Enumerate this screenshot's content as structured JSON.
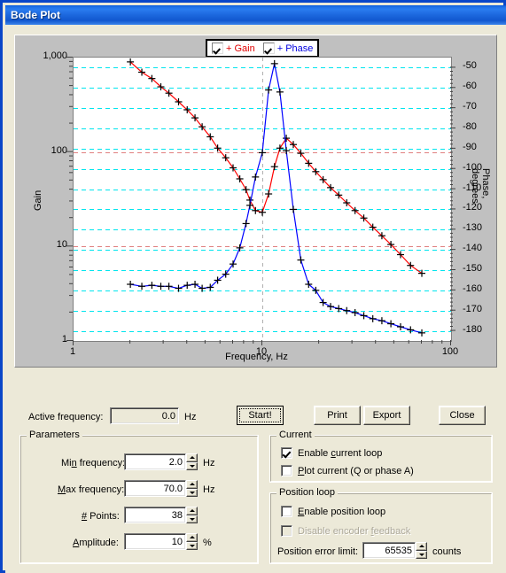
{
  "window": {
    "title": "Bode Plot"
  },
  "chart_data": {
    "type": "line",
    "title": "",
    "xlabel": "Frequency, Hz",
    "ylabel": "Gain",
    "ylabel_right": "Phase, degrees",
    "xscale": "log",
    "yscale_left": "log",
    "xlim": [
      1,
      100
    ],
    "ylim_left": [
      1,
      1000
    ],
    "ylim_right": [
      -185,
      -45
    ],
    "grid": true,
    "grid_color": "#00e5ee",
    "grid_major_color": "#e08080",
    "legend_position": "top-center",
    "xticks": [
      "1",
      "10",
      "100"
    ],
    "yticks_left": [
      "1",
      "10",
      "100",
      "1,000"
    ],
    "yticks_right": [
      "-50",
      "-60",
      "-70",
      "-80",
      "-90",
      "-100",
      "-110",
      "-120",
      "-130",
      "-140",
      "-150",
      "-160",
      "-170",
      "-180"
    ],
    "legend": [
      {
        "label": "+ Gain",
        "color": "#ff0000",
        "checked": true
      },
      {
        "label": "+ Phase",
        "color": "#0000ff",
        "checked": true
      }
    ],
    "x": [
      2.0,
      2.3,
      2.6,
      2.9,
      3.2,
      3.6,
      4.0,
      4.4,
      4.8,
      5.3,
      5.8,
      6.4,
      7.0,
      7.6,
      8.2,
      8.6,
      9.2,
      10.0,
      10.8,
      11.6,
      12.4,
      13.4,
      14.6,
      16.0,
      17.6,
      19.2,
      21.0,
      23.0,
      25.4,
      28.0,
      31.0,
      34.5,
      38.5,
      43.0,
      48.0,
      54.0,
      61.0,
      70.0
    ],
    "series": [
      {
        "name": "+ Gain",
        "color": "#ff0000",
        "marker": "plus",
        "values": [
          900,
          700,
          600,
          490,
          420,
          340,
          280,
          230,
          185,
          145,
          110,
          87,
          68,
          52,
          40,
          31,
          24,
          23,
          36,
          70,
          110,
          140,
          120,
          97,
          76,
          62,
          51,
          42,
          35,
          29,
          24,
          20,
          16,
          13,
          10.5,
          8.2,
          6.3,
          5.2
        ]
      },
      {
        "name": "+ Phase",
        "color": "#0000ff",
        "marker": "plus",
        "values": [
          -157,
          -158,
          -157.5,
          -158,
          -158,
          -159,
          -157.5,
          -157,
          -159,
          -158.5,
          -155,
          -152,
          -147,
          -139,
          -127,
          -118,
          -104,
          -92,
          -61,
          -48,
          -62,
          -91,
          -120,
          -145,
          -157,
          -160,
          -166,
          -168,
          -169,
          -170,
          -171,
          -172.5,
          -174,
          -175,
          -176.5,
          -178,
          -179.5,
          -181
        ]
      }
    ]
  },
  "toolbar": {
    "active_frequency_label": "Active frequency:",
    "active_frequency_value": "0.0",
    "active_frequency_unit": "Hz",
    "start_label": "Start!",
    "print_label": "Print",
    "export_label": "Export",
    "close_label": "Close"
  },
  "parameters": {
    "group_title": "Parameters",
    "rows": [
      {
        "label": "Min frequency:",
        "value": "2.0",
        "unit": "Hz"
      },
      {
        "label": "Max frequency:",
        "value": "70.0",
        "unit": "Hz"
      },
      {
        "label": "# Points:",
        "value": "38",
        "unit": ""
      },
      {
        "label": "Amplitude:",
        "value": "10",
        "unit": "%"
      }
    ]
  },
  "current": {
    "group_title": "Current",
    "enable_current_loop": "Enable current loop",
    "enable_current_loop_checked": true,
    "plot_current": "Plot current (Q or phase A)",
    "plot_current_checked": false
  },
  "position_loop": {
    "group_title": "Position loop",
    "enable_position_loop": "Enable position loop",
    "enable_position_loop_checked": false,
    "disable_encoder_feedback": "Disable encoder feedback",
    "disable_encoder_feedback_checked": false,
    "position_error_limit_label": "Position error limit:",
    "position_error_limit_value": "65535",
    "position_error_limit_unit": "counts"
  }
}
